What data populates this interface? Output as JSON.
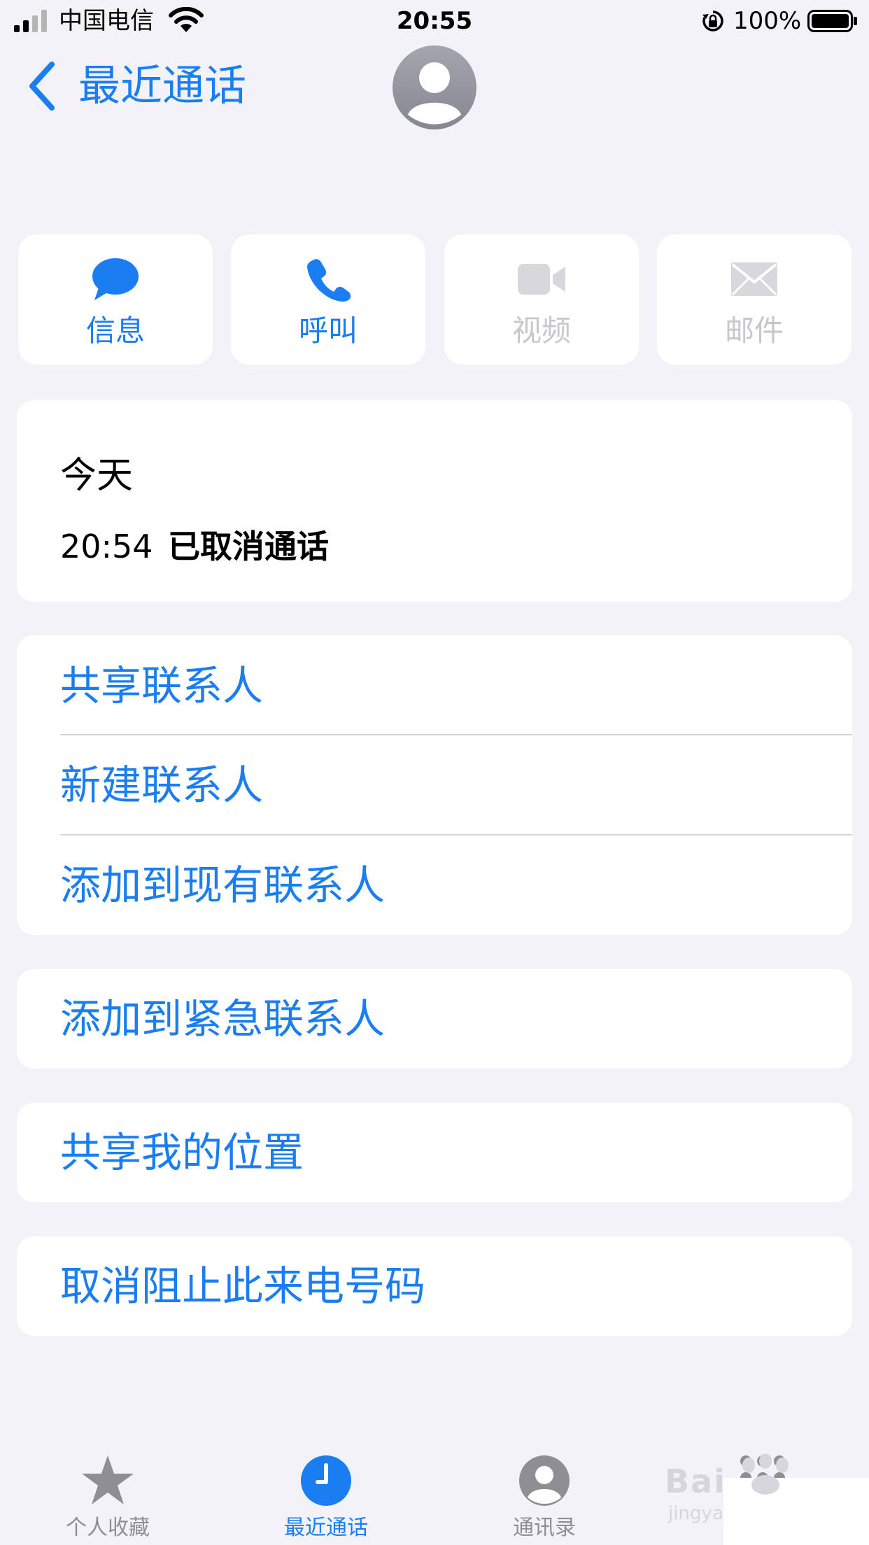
{
  "status_bar": {
    "carrier": "中国电信",
    "time": "20:55",
    "battery": "100%"
  },
  "header": {
    "back_label": "最近通话"
  },
  "actions": [
    {
      "label": "信息",
      "icon": "message-bubble-icon",
      "enabled": true
    },
    {
      "label": "呼叫",
      "icon": "phone-icon",
      "enabled": true
    },
    {
      "label": "视频",
      "icon": "video-camera-icon",
      "enabled": false
    },
    {
      "label": "邮件",
      "icon": "envelope-icon",
      "enabled": false
    }
  ],
  "call_log": {
    "day": "今天",
    "time": "20:54",
    "status": "已取消通话"
  },
  "options_group1": [
    "共享联系人",
    "新建联系人",
    "添加到现有联系人"
  ],
  "emergency": "添加到紧急联系人",
  "share_location": "共享我的位置",
  "unblock": "取消阻止此来电号码",
  "tabs": [
    {
      "label": "个人收藏",
      "icon": "star-icon",
      "active": false
    },
    {
      "label": "最近通话",
      "icon": "clock-icon",
      "active": true
    },
    {
      "label": "通讯录",
      "icon": "contacts-icon",
      "active": false
    },
    {
      "label": "",
      "icon": "keypad-icon",
      "active": false
    }
  ],
  "watermark": {
    "brand": "Bai",
    "sub": "jingya"
  },
  "colors": {
    "accent": "#1a7df2",
    "disabled": "#c7c7cc",
    "background": "#f2f2f7"
  }
}
